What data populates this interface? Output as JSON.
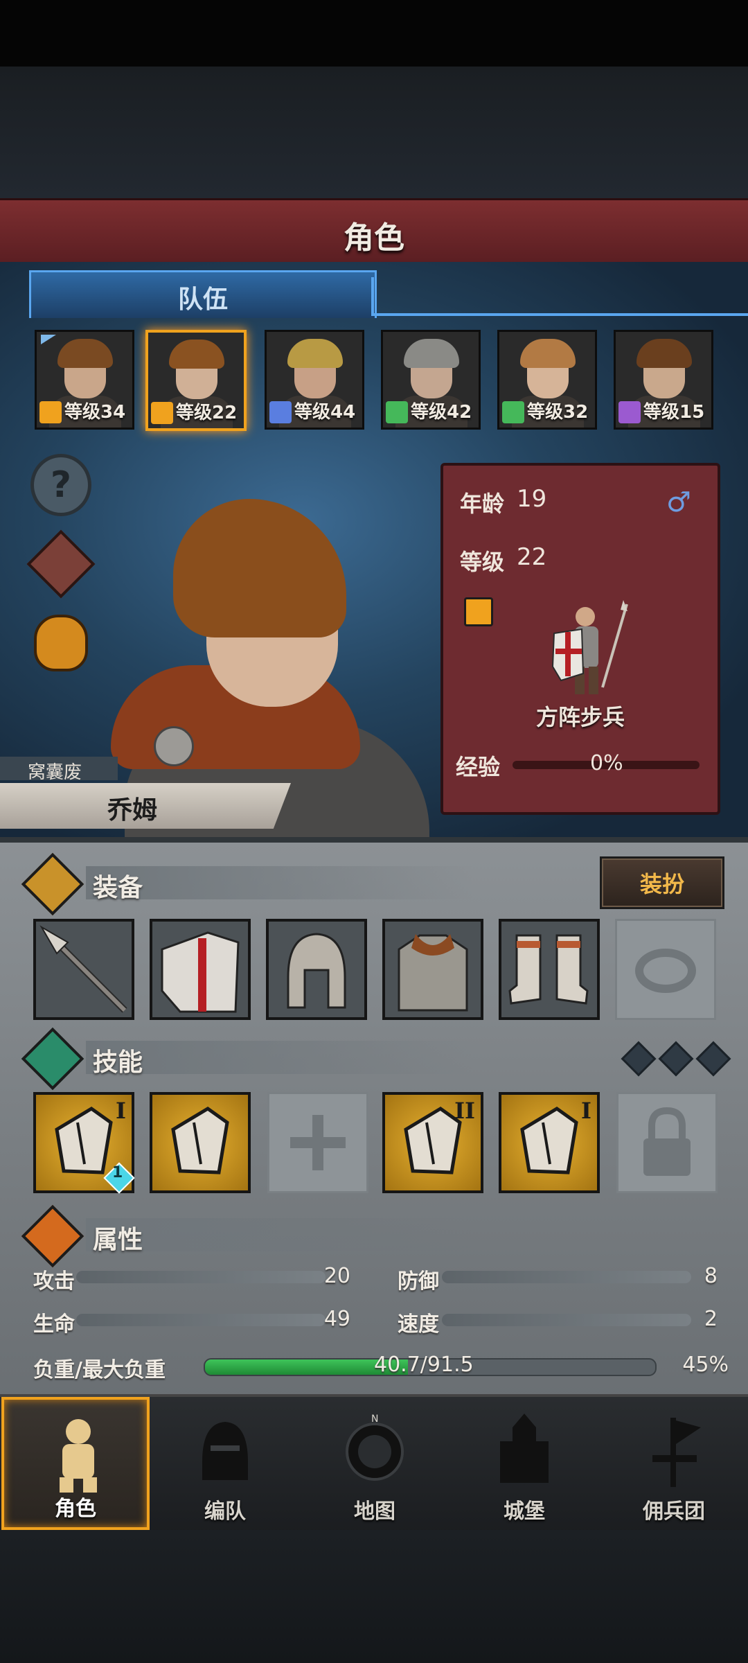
{
  "title": "角色",
  "team_tab": "队伍",
  "party": [
    {
      "level_text": "等级34",
      "class_color": "#f0a21e",
      "class_icon": "shield-icon",
      "hair": "#7a4a22",
      "skin": "#c9a68a",
      "leader": true
    },
    {
      "level_text": "等级22",
      "class_color": "#f0a21e",
      "class_icon": "shield-icon",
      "hair": "#8a5221",
      "skin": "#d0b096",
      "selected": true
    },
    {
      "level_text": "等级44",
      "class_color": "#5a7ee0",
      "class_icon": "sword-icon",
      "hair": "#b89a44",
      "skin": "#c7a086"
    },
    {
      "level_text": "等级42",
      "class_color": "#45b85a",
      "class_icon": "bow-icon",
      "hair": "#8a8a86",
      "skin": "#c4a690"
    },
    {
      "level_text": "等级32",
      "class_color": "#45b85a",
      "class_icon": "bow-icon",
      "hair": "#b27a44",
      "skin": "#d6b498"
    },
    {
      "level_text": "等级15",
      "class_color": "#9b5ad0",
      "class_icon": "staff-icon",
      "hair": "#6a3f1e",
      "skin": "#c9a88c"
    }
  ],
  "character": {
    "nickname": "窝囊废",
    "name": "乔姆",
    "age_label": "年龄",
    "age": "19",
    "level_label": "等级",
    "level": "22",
    "unit_name": "方阵步兵",
    "exp_label": "经验",
    "exp_percent": "0%",
    "exp_fraction": 0.0
  },
  "equipment": {
    "header": "装备",
    "dress_button": "装扮",
    "slots": [
      "spear",
      "kite-shield",
      "helmet",
      "chainmail",
      "boots",
      "ring-empty"
    ]
  },
  "skills": {
    "header": "技能",
    "slots": [
      {
        "rank": "I",
        "badge": "1"
      },
      {
        "rank": ""
      },
      {
        "rank": "",
        "empty": true
      },
      {
        "rank": "II"
      },
      {
        "rank": "I"
      },
      {
        "rank": "",
        "locked": true
      }
    ]
  },
  "attributes": {
    "header": "属性",
    "attack_label": "攻击",
    "attack": "20",
    "defense_label": "防御",
    "defense": "8",
    "hp_label": "生命",
    "hp": "49",
    "speed_label": "速度",
    "speed": "2",
    "load_label": "负重/最大负重",
    "load_value": "40.7/91.5",
    "load_percent": "45%",
    "load_fraction": 0.45
  },
  "nav": [
    {
      "label": "角色",
      "icon": "knight-icon",
      "active": true
    },
    {
      "label": "编队",
      "icon": "helmet-icon"
    },
    {
      "label": "地图",
      "icon": "compass-icon"
    },
    {
      "label": "城堡",
      "icon": "castle-icon"
    },
    {
      "label": "佣兵团",
      "icon": "banner-icon"
    }
  ]
}
